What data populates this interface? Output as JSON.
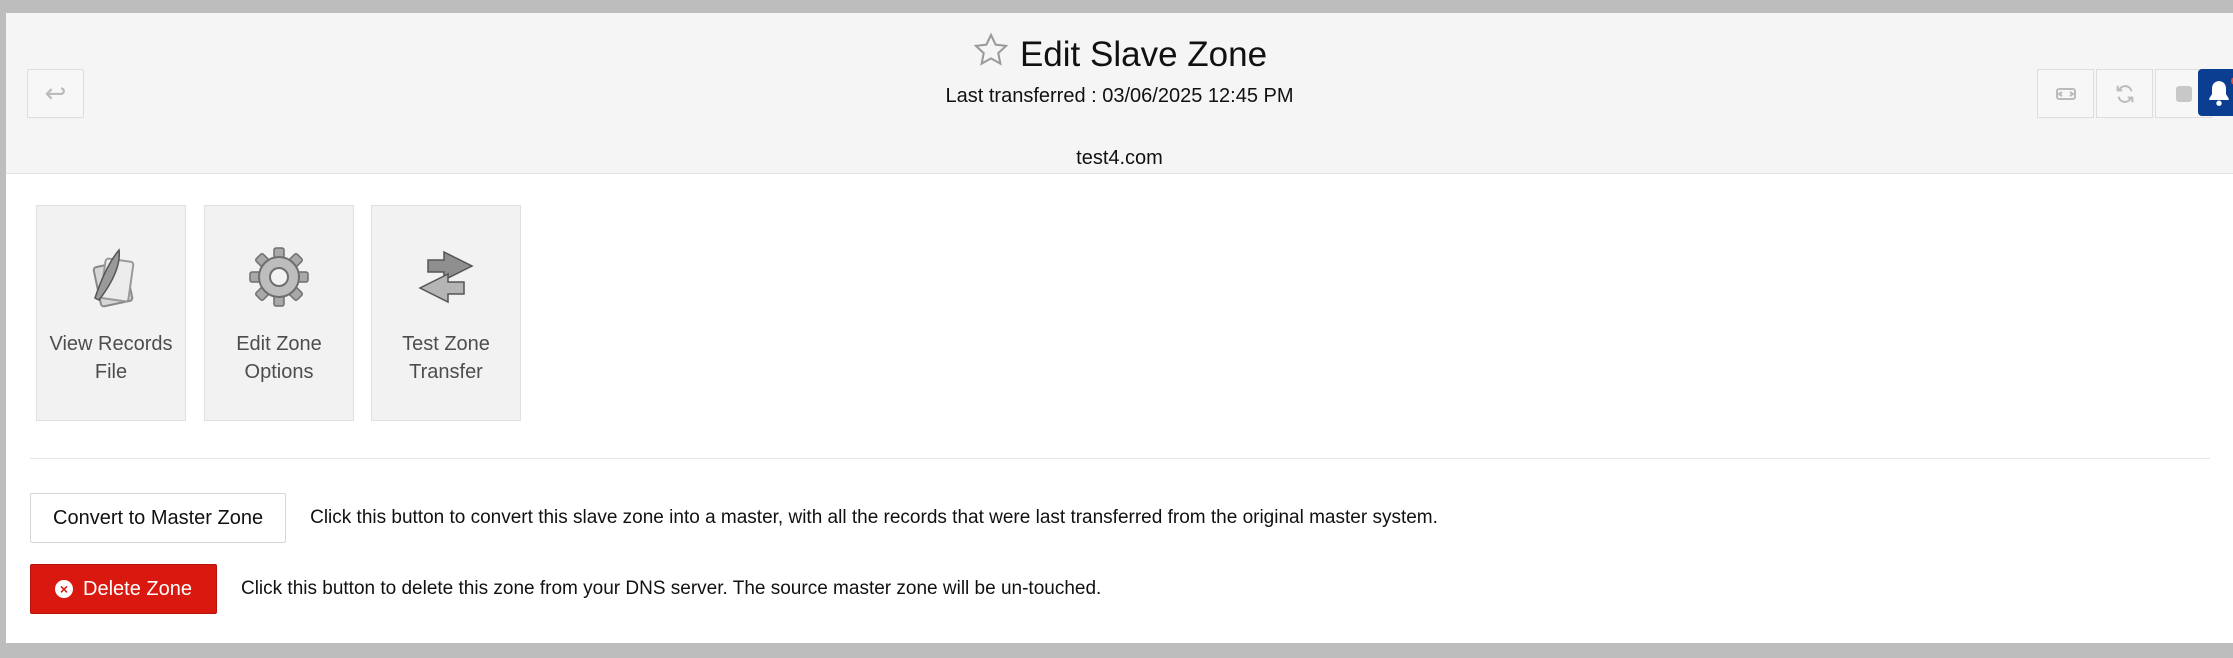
{
  "header": {
    "title": "Edit Slave Zone",
    "last_transferred": "Last transferred : 03/06/2025 12:45 PM",
    "domain": "test4.com"
  },
  "icons": {
    "back": "return-arrow-icon",
    "tools": [
      "transfer-icon",
      "refresh-icon",
      "stop-icon"
    ],
    "notification": "bell-icon",
    "favorite": "star-icon"
  },
  "tiles": [
    {
      "label": "View Records File",
      "icon": "records-quill-icon"
    },
    {
      "label": "Edit Zone Options",
      "icon": "gear-icon"
    },
    {
      "label": "Test Zone Transfer",
      "icon": "transfer-arrows-icon"
    }
  ],
  "actions": {
    "convert": {
      "label": "Convert to Master Zone",
      "description": "Click this button to convert this slave zone into a master, with all the records that were last transferred from the original master system."
    },
    "delete": {
      "label": "Delete Zone",
      "description": "Click this button to delete this zone from your DNS server. The source master zone will be un-touched."
    }
  },
  "colors": {
    "delete_button": "#d9180f",
    "notification_button": "#0b3d91",
    "header_bg": "#f5f5f5"
  }
}
